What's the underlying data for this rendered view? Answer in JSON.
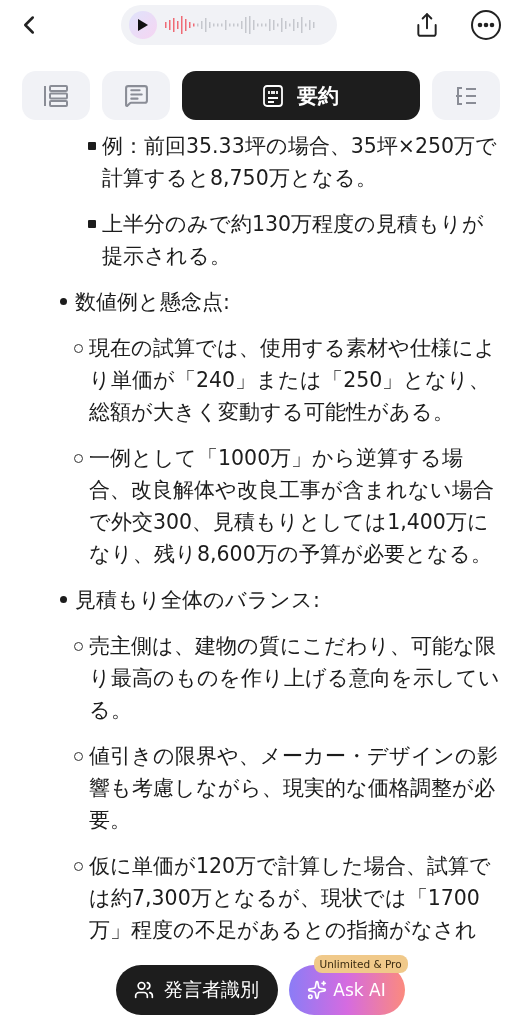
{
  "tabs": [
    {
      "kind": "outline",
      "selected": false
    },
    {
      "kind": "transcript",
      "selected": false
    },
    {
      "kind": "summary",
      "label": "要約",
      "selected": true
    },
    {
      "kind": "chapters",
      "selected": false
    }
  ],
  "summary": {
    "continued": [
      "例：前回35.33坪の場合、35坪×250万で計算すると8,750万となる。",
      "上半分のみで約130万程度の見積もりが提示される。"
    ],
    "sections": [
      {
        "title": "数値例と懸念点:",
        "children": [
          "現在の試算では、使用する素材や仕様により単価が「240」または「250」となり、総額が大きく変動する可能性がある。",
          "一例として「1000万」から逆算する場合、改良解体や改良工事が含まれない場合で外交300、見積もりとしては1,400万になり、残り8,600万の予算が必要となる。"
        ]
      },
      {
        "title": "見積もり全体のバランス:",
        "children": [
          "売主側は、建物の質にこだわり、可能な限り最高のものを作り上げる意向を示している。",
          "値引きの限界や、メーカー・デザインの影響も考慮しながら、現実的な価格調整が必要。",
          "仮に単価が120万で計算した場合、試算では約7,300万となるが、現状では「1700万」程度の不足があるとの指摘がなされ"
        ]
      }
    ]
  },
  "actions": {
    "speaker": "発言者識別",
    "ask": "Ask AI",
    "badge": "Unlimited & Pro"
  }
}
